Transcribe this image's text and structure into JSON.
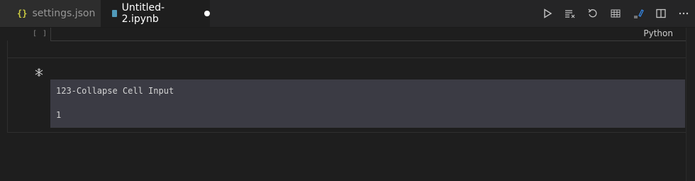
{
  "tabs": [
    {
      "label": "settings.json",
      "icon": "braces-icon",
      "active": false
    },
    {
      "label": "Untitled-2.ipynb",
      "icon": "notebook-icon",
      "active": true,
      "dirty": true
    }
  ],
  "toolbar": {
    "actions": [
      "run-all-icon",
      "clear-outputs-icon",
      "restart-kernel-icon",
      "variables-icon",
      "select-kernel-icon",
      "split-editor-icon",
      "more-actions-icon"
    ]
  },
  "cell1": {
    "bracket": "[ ]",
    "language": "Python"
  },
  "cell2": {
    "title": "123-Collapse Cell Input",
    "value": "1",
    "collapse_icon": "collapse-icon"
  },
  "colors": {
    "accent_text": "#ffffff",
    "cell_bg": "#3b3b44",
    "notebook_icon": "#519aba",
    "braces_icon": "#cbcb41"
  }
}
